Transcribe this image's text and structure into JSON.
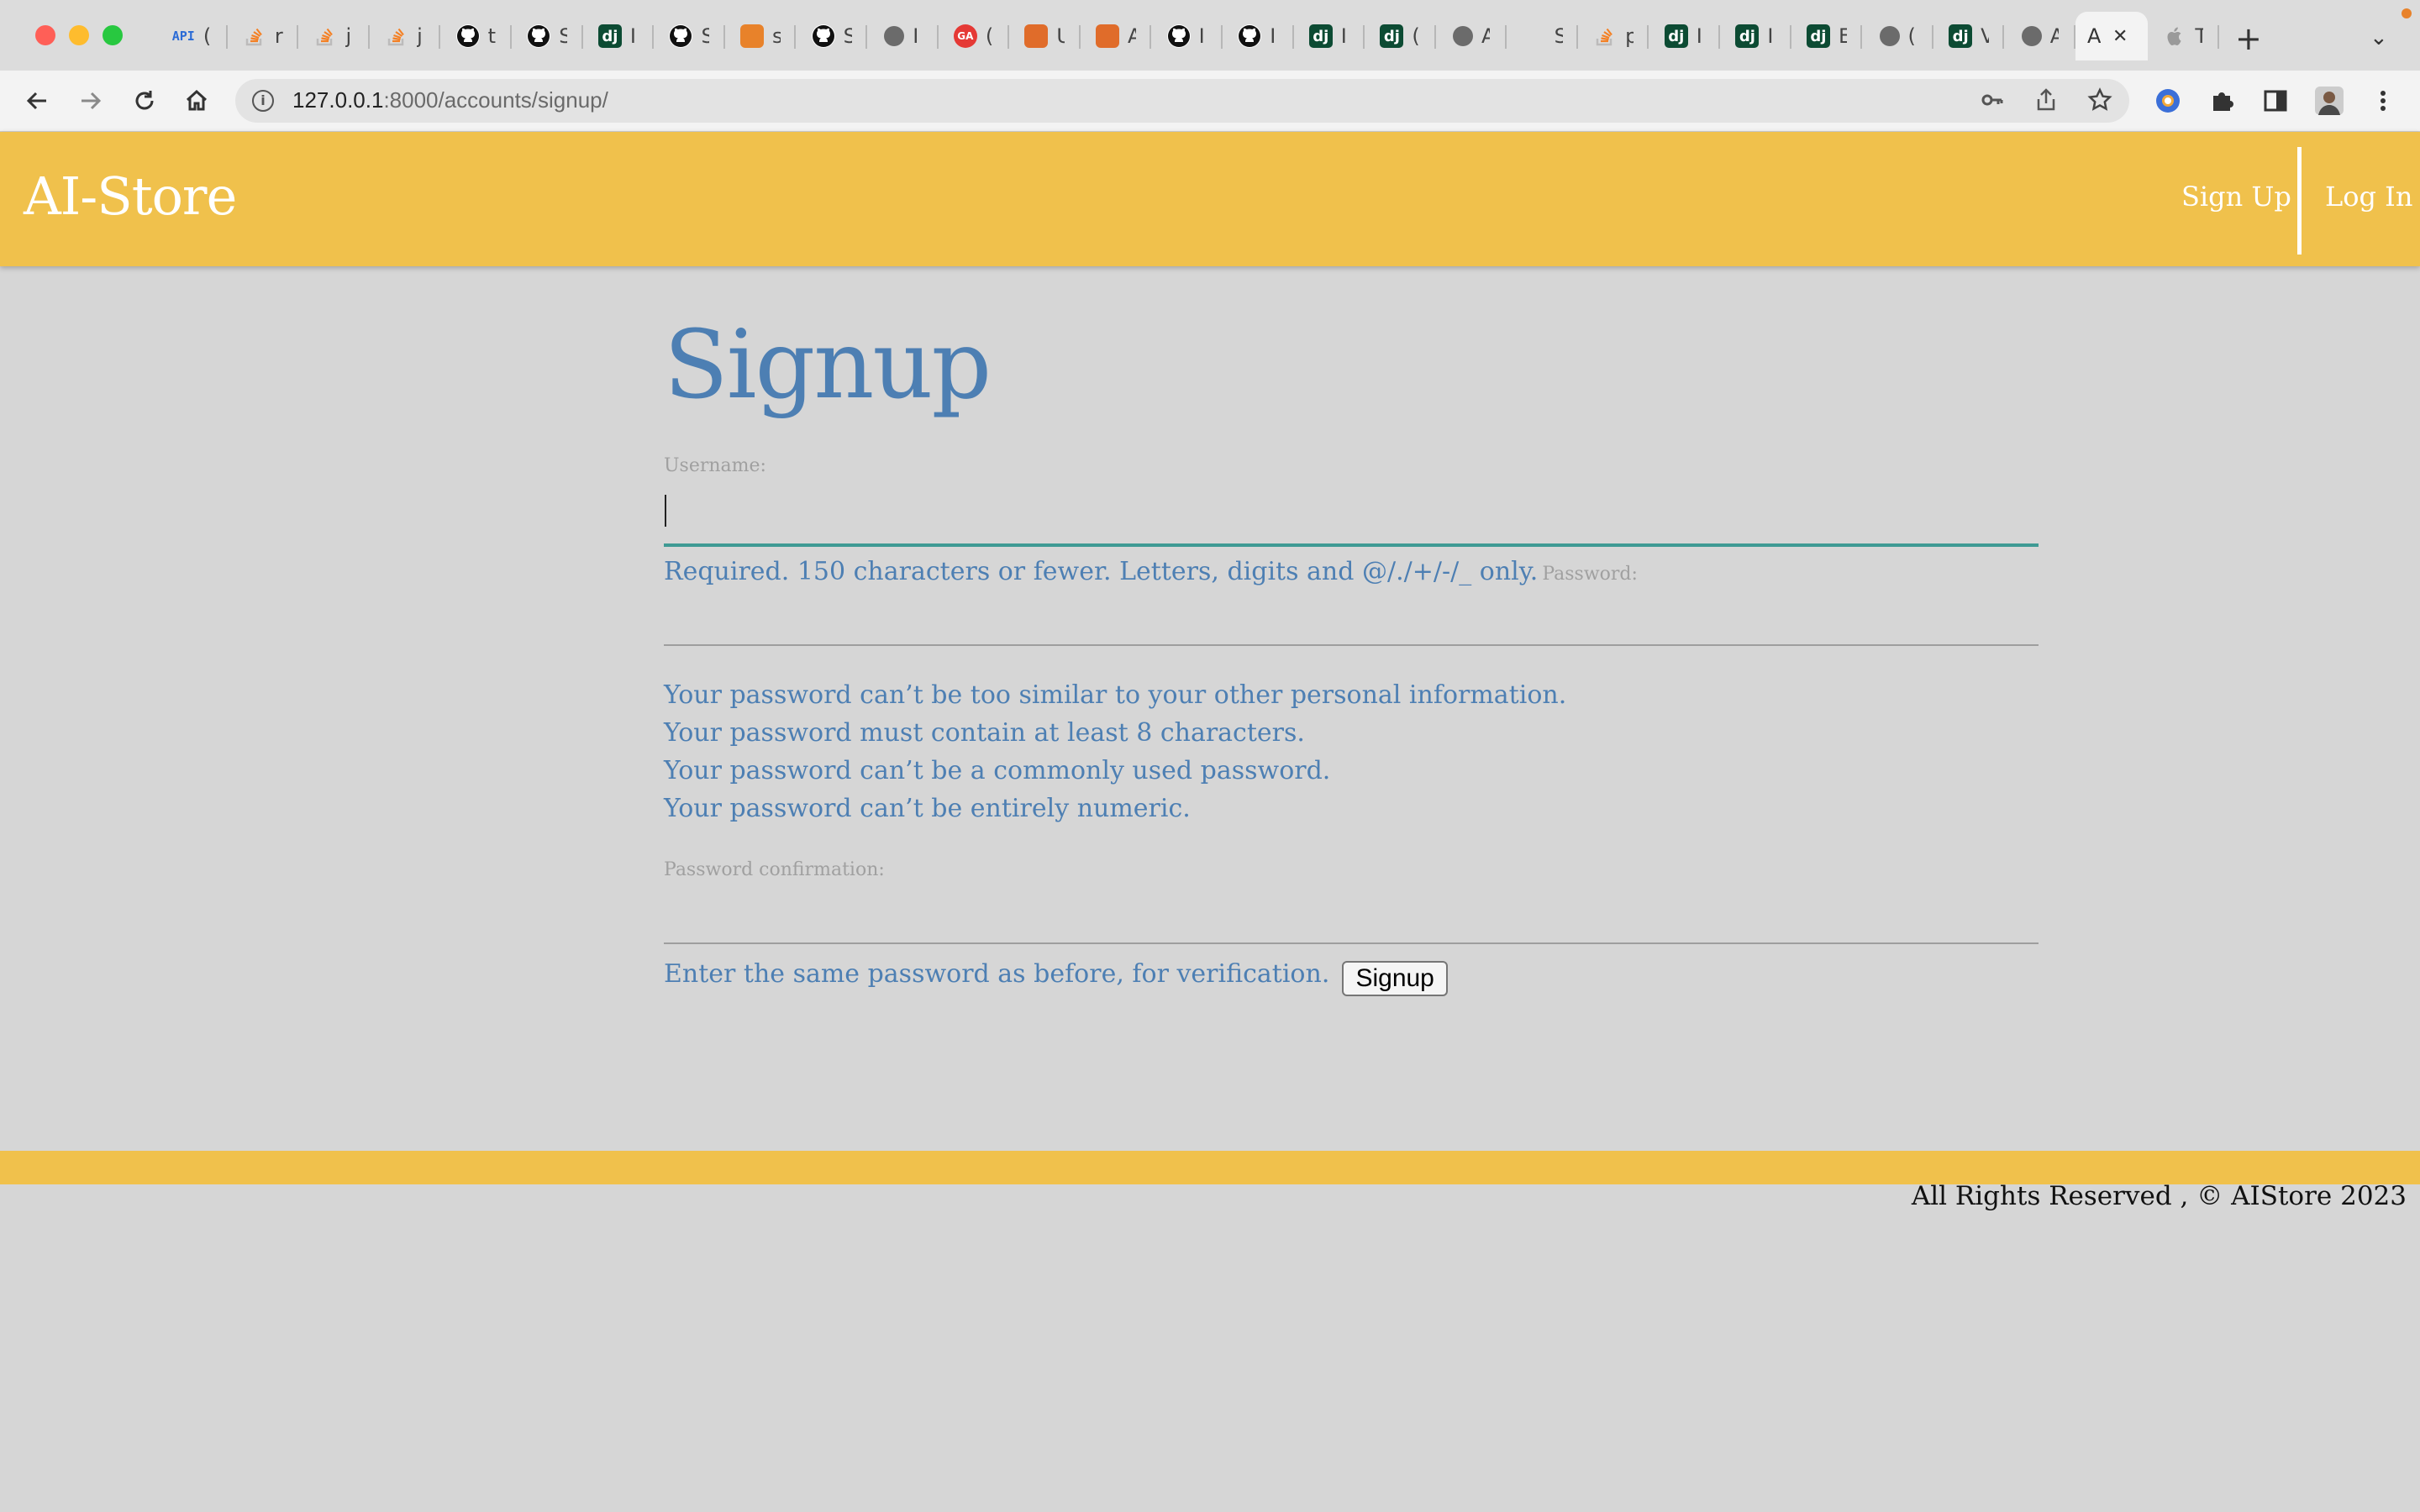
{
  "browser": {
    "url_host": "127.0.0.1",
    "url_path": ":8000/accounts/signup/",
    "tabs": [
      {
        "icon": "api-icon",
        "glyph": "API",
        "title": "("
      },
      {
        "icon": "stackoverflow-icon",
        "glyph": "",
        "title": "r"
      },
      {
        "icon": "stackoverflow-icon",
        "glyph": "",
        "title": "j"
      },
      {
        "icon": "stackoverflow-icon",
        "glyph": "",
        "title": "j"
      },
      {
        "icon": "github-icon",
        "glyph": "",
        "title": "t"
      },
      {
        "icon": "github-icon",
        "glyph": "",
        "title": "S"
      },
      {
        "icon": "django-icon",
        "glyph": "dj",
        "title": "I"
      },
      {
        "icon": "github-icon",
        "glyph": "",
        "title": "S"
      },
      {
        "icon": "package-icon",
        "glyph": "",
        "title": "s"
      },
      {
        "icon": "github-icon",
        "glyph": "",
        "title": "S"
      },
      {
        "icon": "globe-icon",
        "glyph": "",
        "title": "I"
      },
      {
        "icon": "ga-icon",
        "glyph": "GA",
        "title": "("
      },
      {
        "icon": "network-icon",
        "glyph": "",
        "title": "U"
      },
      {
        "icon": "network-icon",
        "glyph": "",
        "title": "A"
      },
      {
        "icon": "github-icon",
        "glyph": "",
        "title": "I"
      },
      {
        "icon": "github-icon",
        "glyph": "",
        "title": "I"
      },
      {
        "icon": "django-icon",
        "glyph": "dj",
        "title": "I"
      },
      {
        "icon": "django-icon",
        "glyph": "dj",
        "title": "("
      },
      {
        "icon": "globe-icon",
        "glyph": "",
        "title": "A"
      },
      {
        "icon": "mx-icon",
        "glyph": "",
        "title": "S"
      },
      {
        "icon": "stackoverflow-icon",
        "glyph": "",
        "title": "p"
      },
      {
        "icon": "django-icon",
        "glyph": "dj",
        "title": "I"
      },
      {
        "icon": "django-icon",
        "glyph": "dj",
        "title": "I"
      },
      {
        "icon": "django-icon",
        "glyph": "dj",
        "title": "E"
      },
      {
        "icon": "globe-icon",
        "glyph": "",
        "title": "("
      },
      {
        "icon": "django-icon",
        "glyph": "dj",
        "title": "V"
      },
      {
        "icon": "globe-icon",
        "glyph": "",
        "title": "A"
      }
    ],
    "active_tab": {
      "title": "A",
      "close": "✕"
    },
    "last_tab": {
      "icon": "apple-icon",
      "glyph": "",
      "title": "T"
    },
    "new_tab": "+",
    "tab_menu": "⌄"
  },
  "site": {
    "brand": "AI-Store",
    "nav": {
      "signup": "Sign Up",
      "login": "Log In"
    }
  },
  "form": {
    "title": "Signup",
    "username_label": "Username:",
    "username_help": "Required. 150 characters or fewer. Letters, digits and @/./+/-/_ only.",
    "password_label": "Password:",
    "password_rules": [
      "Your password can’t be too similar to your other personal information.",
      "Your password must contain at least 8 characters.",
      "Your password can’t be a commonly used password.",
      "Your password can’t be entirely numeric."
    ],
    "confirm_label": "Password confirmation:",
    "confirm_help": "Enter the same password as before, for verification.",
    "submit": "Signup"
  },
  "footer": {
    "copyright": "All Rights Reserved , © AIStore 2023"
  },
  "colors": {
    "navbar": "#f0c14c",
    "page_bg": "#d6d6d6",
    "accent_text": "#4d7fb3",
    "focus_line": "#3f9a94"
  }
}
